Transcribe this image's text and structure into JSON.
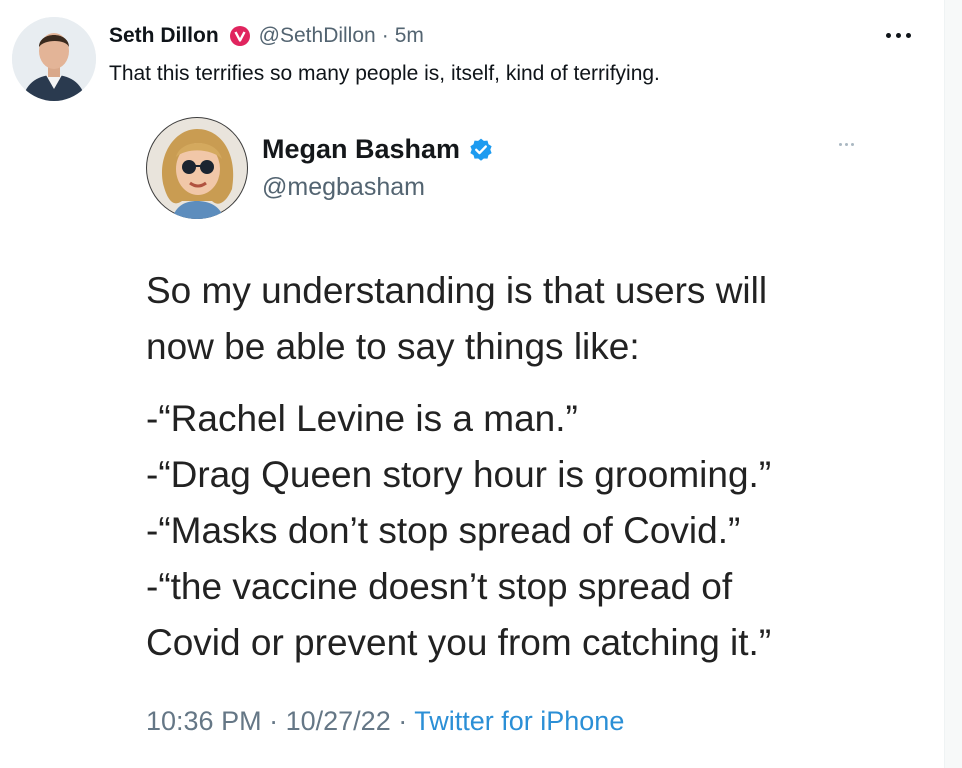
{
  "tweet": {
    "author_name": "Seth Dillon",
    "author_handle": "@SethDillon",
    "separator": "·",
    "time": "5m",
    "text": "That this terrifies so many people is, itself, kind of terrifying.",
    "badge_icon": "verified-red-badge-icon",
    "more_icon": "more-options-icon"
  },
  "quoted": {
    "author_name": "Megan Basham",
    "author_handle": "@megbasham",
    "badge_icon": "verified-blue-badge-icon",
    "lines": [
      "So my understanding is that users will",
      "now be able to say things like:"
    ],
    "quotes": [
      "-“Rachel Levine is a man.”",
      "-“Drag Queen story hour is grooming.”",
      "-“Masks don’t stop spread of Covid.”",
      "-“the vaccine doesn’t stop spread of",
      "Covid or prevent you from catching it.”"
    ],
    "time": "10:36 PM",
    "date": "10/27/22",
    "separator": "·",
    "source": "Twitter for iPhone"
  },
  "colors": {
    "verified_red": "#e0245e",
    "verified_blue": "#1d9bf0",
    "link": "#2b8fd6",
    "secondary_text": "#536471"
  }
}
